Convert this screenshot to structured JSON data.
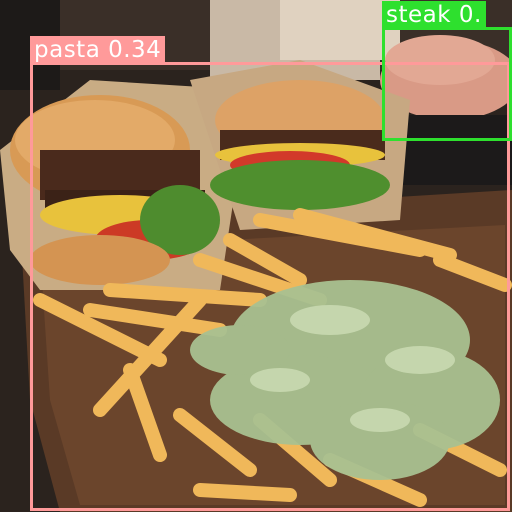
{
  "detections": {
    "pasta": {
      "label": "pasta 0.34",
      "color": "#ff9a9a"
    },
    "steak": {
      "label": "steak 0.",
      "color": "#2ee02e"
    }
  },
  "image": {
    "subject": "burgers with cheese, lettuce and tomato next to fries drizzled with green sauce on a wooden board"
  }
}
